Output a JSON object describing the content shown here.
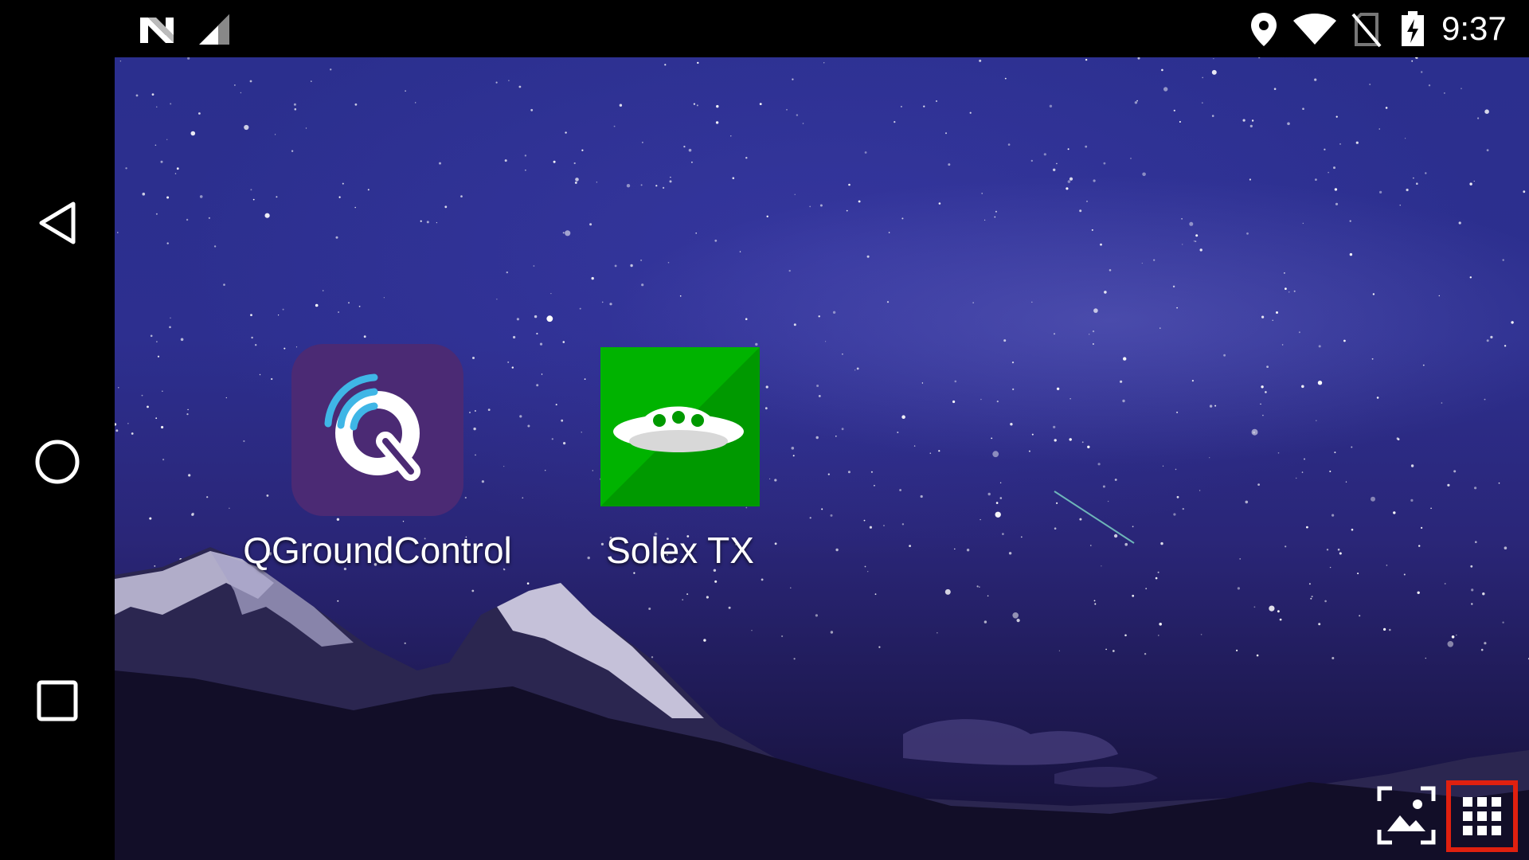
{
  "status_bar": {
    "time": "9:37",
    "icons": [
      "n-notification-icon",
      "cellular-signal-icon",
      "location-icon",
      "wifi-icon",
      "no-sim-icon",
      "battery-charging-icon"
    ]
  },
  "nav_bar": {
    "buttons": [
      "back-icon",
      "home-icon",
      "recents-icon"
    ]
  },
  "home": {
    "apps": [
      {
        "label": "QGroundControl",
        "icon": "qgroundcontrol-app-icon",
        "icon_color": "#4b2a74",
        "accent_color": "#3fb6e6"
      },
      {
        "label": "Solex TX",
        "icon": "solex-tx-app-icon",
        "icon_color": "#00b300",
        "accent_color": "#009900"
      }
    ],
    "actions": {
      "wallpaper": "wallpaper-icon",
      "app_drawer": "app-drawer-grid-icon",
      "highlight_color": "#e0200f"
    }
  }
}
